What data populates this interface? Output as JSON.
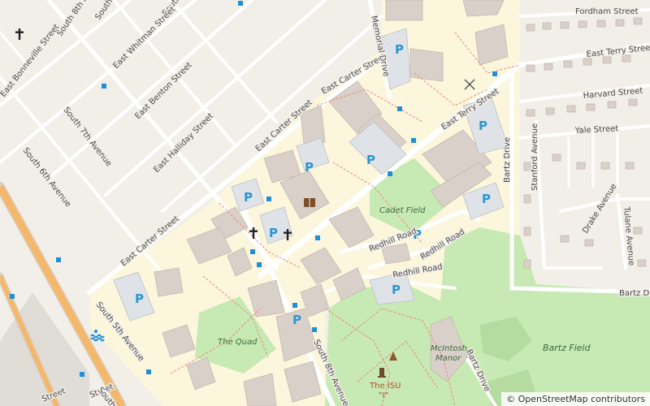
{
  "streets": {
    "south_9th": "South 9th Avenue",
    "south_10th": "South 10th Avenue",
    "south_8th": "South 8th Avenue",
    "south_7th": "South 7th Avenue",
    "south_6th": "South 6th Avenue",
    "south_5th": "South 5th Avenue",
    "south_8th_lower": "South 8th Avenue",
    "east_bonneville": "East Bonneville Street",
    "east_whitman": "East Whitman Street",
    "east_benton": "East Benton Street",
    "east_halliday": "East Halliday Street",
    "east_carter_1": "East Carter Street",
    "east_carter_2": "East Carter Street",
    "east_carter_3": "East Carter Street",
    "memorial": "Memorial Drive",
    "east_terry_1": "East Terry Street",
    "east_terry_2": "East Terry Street",
    "fordham": "Fordham Street",
    "harvard": "Harvard Street",
    "yale": "Yale Street",
    "bartz_drive_1": "Bartz Drive",
    "bartz_drive_2": "Bartz Drive",
    "bartz_drive_3": "Bartz Drive",
    "stanford": "Stanford Avenue",
    "drake": "Drake Avenue",
    "tulane": "Tulane Avenue",
    "redhill_1": "Redhill Road",
    "redhill_2": "Redhill Road",
    "redhill_3": "Redhill Road",
    "street_partial_1": "Street",
    "street_partial_2": "Street",
    "south_partial": "South"
  },
  "places": {
    "cadet_field": "Cadet Field",
    "the_quad": "The Quad",
    "mcintosh_line1": "McIntosh",
    "mcintosh_line2": "Manor",
    "isu_line1": "The ISU",
    "isu_line2": "\"I\"",
    "bartz_field": "Bartz Field"
  },
  "parking_label": "P",
  "attribution": {
    "symbol": "©",
    "text": "OpenStreetMap contributors"
  }
}
